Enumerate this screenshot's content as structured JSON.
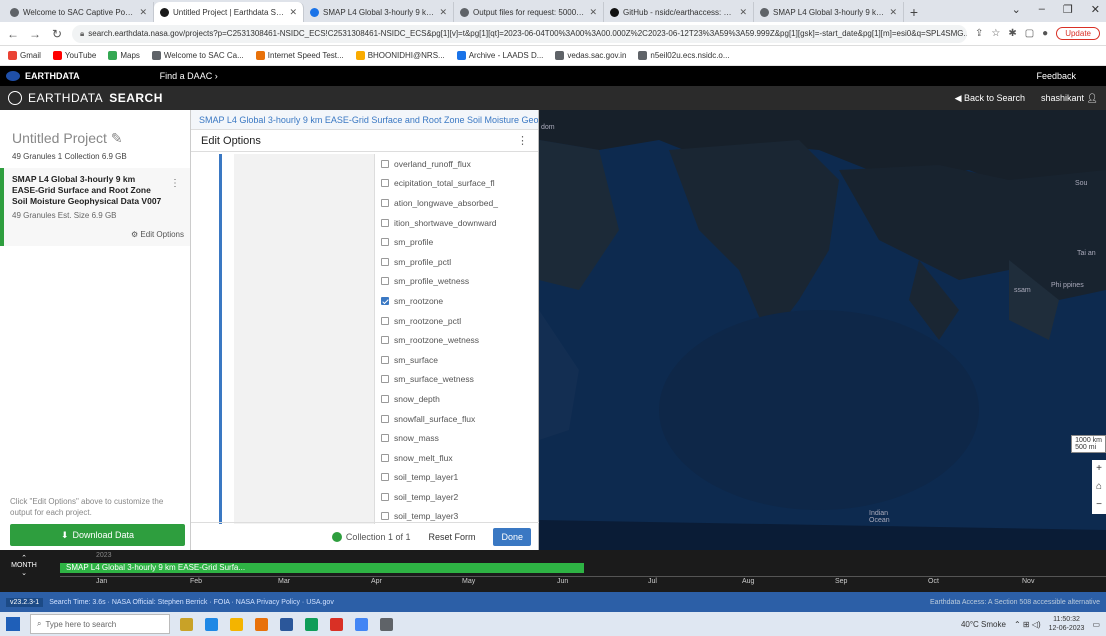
{
  "browser": {
    "tabs": [
      {
        "label": "Welcome to SAC Captive Portal",
        "active": false
      },
      {
        "label": "Untitled Project | Earthdata Sear",
        "active": true
      },
      {
        "label": "SMAP L4 Global 3-hourly 9 km E",
        "active": false
      },
      {
        "label": "Output files for request: 5000004",
        "active": false
      },
      {
        "label": "GitHub - nsidc/earthaccess: Pyth",
        "active": false
      },
      {
        "label": "SMAP L4 Global 3-hourly 9 km E",
        "active": false
      }
    ],
    "url": "search.earthdata.nasa.gov/projects?p=C2531308461-NSIDC_ECS!C2531308461-NSIDC_ECS&pg[1][v]=t&pg[1][qt]=2023-06-04T00%3A00%3A00.000Z%2C2023-06-12T23%3A59%3A59.999Z&pg[1][gsk]=-start_date&pg[1][m]=esi0&q=SPL4SMG...",
    "update_label": "Update",
    "bookmarks": [
      {
        "label": "Gmail",
        "color": "#ea4335"
      },
      {
        "label": "YouTube",
        "color": "#ff0000"
      },
      {
        "label": "Maps",
        "color": "#34a853"
      },
      {
        "label": "Welcome to SAC Ca...",
        "color": "#5f6368"
      },
      {
        "label": "Internet Speed Test...",
        "color": "#e8710a"
      },
      {
        "label": "BHOONIDHI@NRS...",
        "color": "#f9ab00"
      },
      {
        "label": "Archive - LAADS D...",
        "color": "#1a73e8"
      },
      {
        "label": "vedas.sac.gov.in",
        "color": "#5f6368"
      },
      {
        "label": "n5eil02u.ecs.nsidc.o...",
        "color": "#5f6368"
      }
    ]
  },
  "earthdata": {
    "brand": "EARTHDATA",
    "find_daac": "Find a DAAC ›",
    "feedback": "Feedback",
    "search_brand_light": "EARTHDATA",
    "search_brand_bold": "SEARCH",
    "back_to_search": "Back to Search",
    "user": "shashikant"
  },
  "project": {
    "title": "Untitled Project",
    "meta": "49 Granules  1 Collection  6.9 GB",
    "collection_title": "SMAP L4 Global 3-hourly 9 km EASE-Grid Surface and Root Zone Soil Moisture Geophysical Data V007",
    "collection_meta": "49 Granules  Est. Size 6.9 GB",
    "edit_options": "Edit Options",
    "note": "Click \"Edit Options\" above to customize the output for each project.",
    "download": "Download Data"
  },
  "edit_panel": {
    "collection_title": "SMAP L4 Global 3-hourly 9 km EASE-Grid Surface and Root Zone Soil Moisture Geophy",
    "heading": "Edit Options",
    "variables": [
      {
        "name": "overland_runoff_flux",
        "checked": false
      },
      {
        "name": "ecipitation_total_surface_fl",
        "checked": false
      },
      {
        "name": "ation_longwave_absorbed_",
        "checked": false
      },
      {
        "name": "ition_shortwave_downward",
        "checked": false
      },
      {
        "name": "sm_profile",
        "checked": false
      },
      {
        "name": "sm_profile_pctl",
        "checked": false
      },
      {
        "name": "sm_profile_wetness",
        "checked": false
      },
      {
        "name": "sm_rootzone",
        "checked": true
      },
      {
        "name": "sm_rootzone_pctl",
        "checked": false
      },
      {
        "name": "sm_rootzone_wetness",
        "checked": false
      },
      {
        "name": "sm_surface",
        "checked": false
      },
      {
        "name": "sm_surface_wetness",
        "checked": false
      },
      {
        "name": "snow_depth",
        "checked": false
      },
      {
        "name": "snowfall_surface_flux",
        "checked": false
      },
      {
        "name": "snow_mass",
        "checked": false
      },
      {
        "name": "snow_melt_flux",
        "checked": false
      },
      {
        "name": "soil_temp_layer1",
        "checked": false
      },
      {
        "name": "soil_temp_layer2",
        "checked": false
      },
      {
        "name": "soil_temp_layer3",
        "checked": false
      },
      {
        "name": "soil_temp_layer4",
        "checked": false
      },
      {
        "name": "soil_temp_layer5",
        "checked": false
      }
    ],
    "collection_count": "Collection 1 of 1",
    "reset": "Reset Form",
    "done": "Done"
  },
  "map": {
    "labels": [
      "dom",
      "Sou",
      "Tai an",
      "Phi ppines",
      "Indian Ocean",
      "ssam"
    ],
    "scale_km": "1000 km",
    "scale_mi": "500 mi"
  },
  "timeline": {
    "control": "MONTH",
    "year": "2023",
    "bar_label": "SMAP L4 Global 3-hourly 9 km EASE-Grid Surfa...",
    "months": [
      "Jan",
      "Feb",
      "Mar",
      "Apr",
      "May",
      "Jun",
      "Jul",
      "Aug",
      "Sep",
      "Oct",
      "Nov"
    ]
  },
  "footer": {
    "version": "v23.2.3-1",
    "text": "Search Time: 3.6s · NASA Official: Stephen Berrick · FOIA · NASA Privacy Policy · USA.gov",
    "right": "Earthdata Access: A Section 508 accessible alternative"
  },
  "taskbar": {
    "search_placeholder": "Type here to search",
    "weather": "40°C  Smoke",
    "time": "11:50:32",
    "date": "12-06-2023"
  }
}
